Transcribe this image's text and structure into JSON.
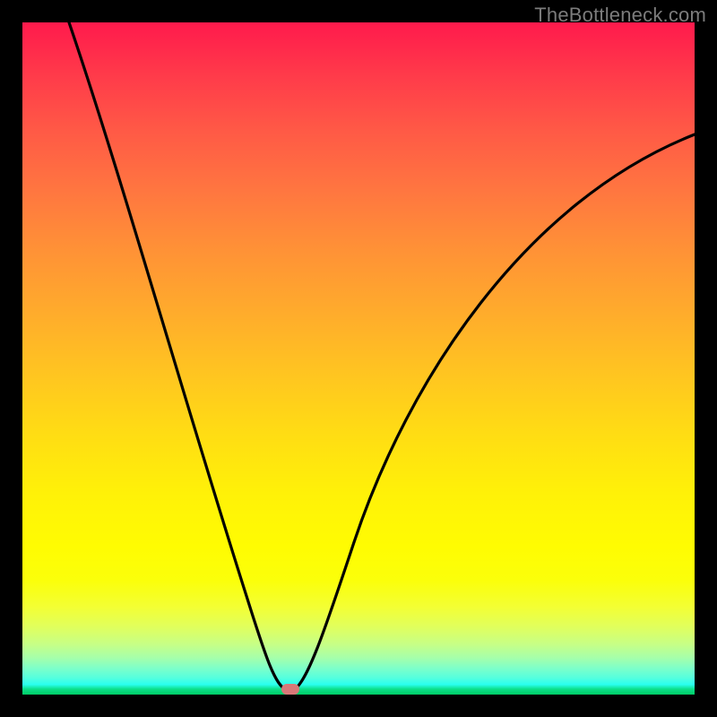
{
  "watermark": "TheBottleneck.com",
  "marker_ratio": 0.39,
  "chart_data": {
    "type": "line",
    "title": "",
    "xlabel": "",
    "ylabel": "",
    "x_range": [
      0,
      100
    ],
    "y_range": [
      0,
      100
    ],
    "optimal_x": 39,
    "series": [
      {
        "name": "bottleneck-curve",
        "x": [
          7,
          12,
          18,
          24,
          30,
          34,
          37,
          39,
          41,
          44,
          48,
          55,
          64,
          74,
          84,
          94,
          100
        ],
        "y": [
          100,
          85,
          68,
          50,
          32,
          18,
          6,
          0,
          6,
          16,
          28,
          42,
          55,
          66,
          74,
          80,
          83
        ]
      }
    ],
    "colors": {
      "curve": "#000000",
      "marker": "#d87878",
      "gradient_top": "#ff1a4c",
      "gradient_bottom": "#00cc66"
    }
  }
}
